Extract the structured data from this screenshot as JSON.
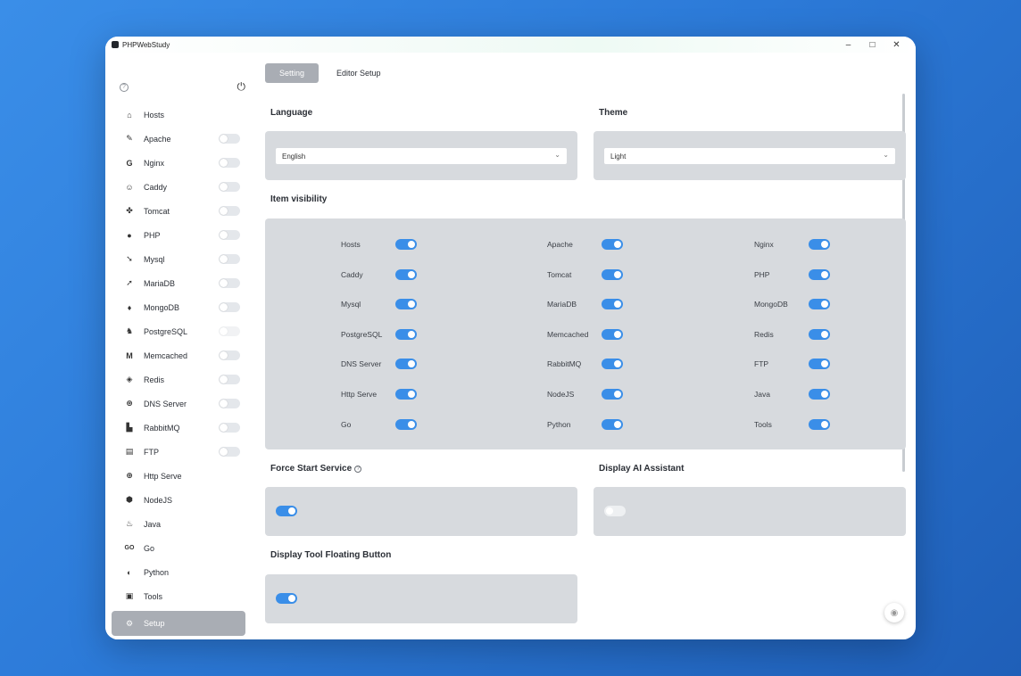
{
  "window": {
    "title": "PHPWebStudy",
    "minimize": "–",
    "maximize": "□",
    "close": "✕"
  },
  "sidebar": {
    "items": [
      {
        "label": "Hosts",
        "icon": "home-icon",
        "glyph": "⌂",
        "toggle": null
      },
      {
        "label": "Apache",
        "icon": "feather-icon",
        "glyph": "✎",
        "toggle": "off"
      },
      {
        "label": "Nginx",
        "icon": "nginx-icon",
        "glyph": "G",
        "toggle": "off"
      },
      {
        "label": "Caddy",
        "icon": "caddy-icon",
        "glyph": "☺",
        "toggle": "off"
      },
      {
        "label": "Tomcat",
        "icon": "tomcat-icon",
        "glyph": "✤",
        "toggle": "off"
      },
      {
        "label": "PHP",
        "icon": "php-icon",
        "glyph": "●",
        "toggle": "off"
      },
      {
        "label": "Mysql",
        "icon": "dolphin-icon",
        "glyph": "➘",
        "toggle": "off"
      },
      {
        "label": "MariaDB",
        "icon": "seal-icon",
        "glyph": "➚",
        "toggle": "off"
      },
      {
        "label": "MongoDB",
        "icon": "leaf-icon",
        "glyph": "♦",
        "toggle": "off"
      },
      {
        "label": "PostgreSQL",
        "icon": "elephant-icon",
        "glyph": "♞",
        "toggle": "disabled"
      },
      {
        "label": "Memcached",
        "icon": "memcached-icon",
        "glyph": "M",
        "toggle": "off"
      },
      {
        "label": "Redis",
        "icon": "layers-icon",
        "glyph": "◈",
        "toggle": "off"
      },
      {
        "label": "DNS Server",
        "icon": "network-icon",
        "glyph": "⊛",
        "toggle": "off"
      },
      {
        "label": "RabbitMQ",
        "icon": "rabbitmq-icon",
        "glyph": "▙",
        "toggle": "off"
      },
      {
        "label": "FTP",
        "icon": "ftp-icon",
        "glyph": "▤",
        "toggle": "off"
      },
      {
        "label": "Http Serve",
        "icon": "globe-icon",
        "glyph": "⊕",
        "toggle": null
      },
      {
        "label": "NodeJS",
        "icon": "hexagon-icon",
        "glyph": "⬢",
        "toggle": null
      },
      {
        "label": "Java",
        "icon": "coffee-icon",
        "glyph": "♨",
        "toggle": null
      },
      {
        "label": "Go",
        "icon": "go-icon",
        "glyph": "GO",
        "toggle": null
      },
      {
        "label": "Python",
        "icon": "python-icon",
        "glyph": "◐",
        "toggle": null
      },
      {
        "label": "Tools",
        "icon": "toolbox-icon",
        "glyph": "▣",
        "toggle": null
      }
    ],
    "active": {
      "label": "Setup",
      "icon": "gear-icon",
      "glyph": "⚙"
    }
  },
  "tabs": [
    "Setting",
    "Editor Setup"
  ],
  "language": {
    "title": "Language",
    "value": "English"
  },
  "theme": {
    "title": "Theme",
    "value": "Light"
  },
  "visibility": {
    "title": "Item visibility",
    "items": [
      [
        "Hosts",
        "Apache",
        "Nginx"
      ],
      [
        "Caddy",
        "Tomcat",
        "PHP"
      ],
      [
        "Mysql",
        "MariaDB",
        "MongoDB"
      ],
      [
        "PostgreSQL",
        "Memcached",
        "Redis"
      ],
      [
        "DNS Server",
        "RabbitMQ",
        "FTP"
      ],
      [
        "Http Serve",
        "NodeJS",
        "Java"
      ],
      [
        "Go",
        "Python",
        "Tools"
      ]
    ]
  },
  "force_start": {
    "title": "Force Start Service",
    "on": true
  },
  "ai_assistant": {
    "title": "Display AI Assistant",
    "on": false
  },
  "floating_button": {
    "title": "Display Tool Floating Button",
    "on": true
  },
  "colors": {
    "accent": "#3a8ee8",
    "panel": "#d7dade",
    "active_nav": "#a9adb4"
  }
}
